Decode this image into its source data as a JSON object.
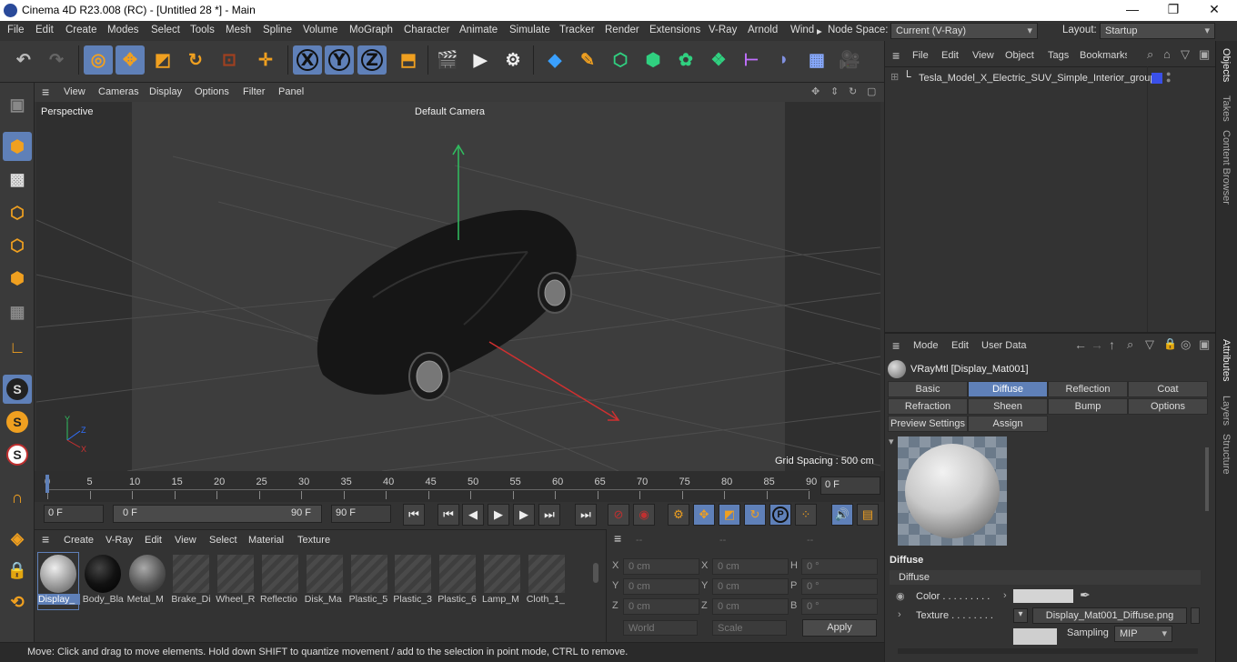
{
  "titlebar": {
    "title": "Cinema 4D R23.008 (RC) - [Untitled 28 *] - Main",
    "minimize": "—",
    "maximize": "❐",
    "close": "✕"
  },
  "menubar": {
    "items": [
      "File",
      "Edit",
      "Create",
      "Modes",
      "Select",
      "Tools",
      "Mesh",
      "Spline",
      "Volume",
      "MoGraph",
      "Character",
      "Animate",
      "Simulate",
      "Tracker",
      "Render",
      "Extensions",
      "V-Ray",
      "Arnold",
      "Wind"
    ],
    "more": "▸",
    "nodespace_label": "Node Space:",
    "nodespace_value": "Current (V-Ray)",
    "layout_label": "Layout:",
    "layout_value": "Startup"
  },
  "toolbar": {
    "x_label": "X",
    "y_label": "Y",
    "z_label": "Z"
  },
  "left_toolbar": {
    "s1": "S",
    "s2": "S",
    "s3": "S"
  },
  "viewport": {
    "menu": [
      "View",
      "Cameras",
      "Display",
      "Options",
      "Filter",
      "Panel"
    ],
    "name": "Perspective",
    "camera": "Default Camera",
    "grid_spacing": "Grid Spacing : 500 cm",
    "axis_y": "Y",
    "axis_z": "Z",
    "axis_x": "X"
  },
  "timeline": {
    "ticks": [
      "0",
      "5",
      "10",
      "15",
      "20",
      "25",
      "30",
      "35",
      "40",
      "45",
      "50",
      "55",
      "60",
      "65",
      "70",
      "75",
      "80",
      "85",
      "90"
    ],
    "current_frame": "0 F"
  },
  "transport": {
    "start_field": "0 F",
    "range_start": "0 F",
    "range_end": "90 F",
    "end_field": "90 F",
    "p_label": "P"
  },
  "material_manager": {
    "menu": [
      "Create",
      "V-Ray",
      "Edit",
      "View",
      "Select",
      "Material",
      "Texture"
    ],
    "materials": [
      {
        "name": "Display_",
        "style": "grey-sphere"
      },
      {
        "name": "Body_Bla",
        "style": "black-sphere"
      },
      {
        "name": "Metal_M",
        "style": "dark-sphere"
      },
      {
        "name": "Brake_Di",
        "style": "empty"
      },
      {
        "name": "Wheel_R",
        "style": "empty"
      },
      {
        "name": "Reflectio",
        "style": "empty"
      },
      {
        "name": "Disk_Ma",
        "style": "empty"
      },
      {
        "name": "Plastic_5",
        "style": "empty"
      },
      {
        "name": "Plastic_3",
        "style": "empty"
      },
      {
        "name": "Plastic_6",
        "style": "empty"
      },
      {
        "name": "Lamp_M",
        "style": "empty"
      },
      {
        "name": "Cloth_1_",
        "style": "empty"
      }
    ]
  },
  "coordinates": {
    "header": [
      "--",
      "--",
      "--"
    ],
    "rows": [
      {
        "a": "X",
        "av": "0 cm",
        "b": "X",
        "bv": "0 cm",
        "c": "H",
        "cv": "0 °"
      },
      {
        "a": "Y",
        "av": "0 cm",
        "b": "Y",
        "bv": "0 cm",
        "c": "P",
        "cv": "0 °"
      },
      {
        "a": "Z",
        "av": "0 cm",
        "b": "Z",
        "bv": "0 cm",
        "c": "B",
        "cv": "0 °"
      }
    ],
    "world": "World",
    "scale": "Scale",
    "apply": "Apply"
  },
  "status": "Move: Click and drag to move elements. Hold down SHIFT to quantize movement / add to the selection in point mode, CTRL to remove.",
  "objects": {
    "menu": [
      "File",
      "Edit",
      "View",
      "Object",
      "Tags",
      "Bookmarks"
    ],
    "items": [
      {
        "name": "Tesla_Model_X_Electric_SUV_Simple_Interior_group",
        "color": "#3a50e8"
      }
    ]
  },
  "attributes": {
    "menu": [
      "Mode",
      "Edit",
      "User Data"
    ],
    "material_title": "VRayMtl [Display_Mat001]",
    "tabs_row1": [
      "Basic",
      "Diffuse",
      "Reflection",
      "Coat"
    ],
    "tabs_row2": [
      "Refraction",
      "Sheen",
      "Bump",
      "Options"
    ],
    "tabs_row3": [
      "Preview Settings",
      "Assign"
    ],
    "selected_tab": "Diffuse",
    "section_title": "Diffuse",
    "group_title": "Diffuse",
    "color_label": "Color . . . . . . . . .",
    "texture_label": "Texture . . . . . . . .",
    "texture_file": "Display_Mat001_Diffuse.png",
    "sampling_label": "Sampling",
    "sampling_value": "MIP"
  },
  "right_tabs": [
    "Objects",
    "Takes",
    "Content Browser",
    "Attributes",
    "Layers",
    "Structure"
  ]
}
